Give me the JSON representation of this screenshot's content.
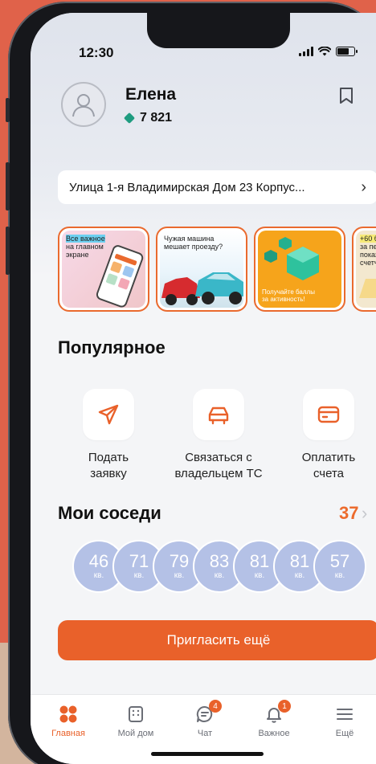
{
  "status_bar": {
    "time": "12:30"
  },
  "profile": {
    "name": "Елена",
    "points": "7 821"
  },
  "address": {
    "text": "Улица 1-я Владимирская Дом 23 Корпус..."
  },
  "stories": [
    {
      "text_line1": "Все важное",
      "text_line2": "на главном",
      "text_line3": "экране"
    },
    {
      "text_line1": "Чужая машина",
      "text_line2": "мешает проезду?"
    },
    {
      "text_line1": "Получайте баллы",
      "text_line2": "за активность!"
    },
    {
      "text_line1": "+60 б",
      "text_line2": "за пер",
      "text_line3": "показ",
      "text_line4": "счетч"
    }
  ],
  "popular": {
    "title": "Популярное",
    "actions": [
      {
        "label_line1": "Подать",
        "label_line2": "заявку",
        "icon": "paper-plane-icon"
      },
      {
        "label_line1": "Связаться с",
        "label_line2": "владельцем ТС",
        "icon": "car-icon"
      },
      {
        "label_line1": "Оплатить",
        "label_line2": "счета",
        "icon": "card-icon"
      }
    ]
  },
  "neighbors": {
    "title": "Мои соседи",
    "count": "37",
    "apartments": [
      {
        "number": "46",
        "suffix": "кв."
      },
      {
        "number": "71",
        "suffix": "кв."
      },
      {
        "number": "79",
        "suffix": "кв."
      },
      {
        "number": "83",
        "suffix": "кв."
      },
      {
        "number": "81",
        "suffix": "кв."
      },
      {
        "number": "81",
        "suffix": "кв."
      },
      {
        "number": "57",
        "suffix": "кв."
      }
    ]
  },
  "invite_button": "Пригласить ещё",
  "tabbar": {
    "items": [
      {
        "label": "Главная",
        "active": true
      },
      {
        "label": "Мой дом"
      },
      {
        "label": "Чат",
        "badge": "4"
      },
      {
        "label": "Важное",
        "badge": "1"
      },
      {
        "label": "Ещё"
      }
    ]
  },
  "colors": {
    "accent": "#e9612a",
    "avatar_bubble": "#b4c1e6",
    "gem": "#1f9c80"
  }
}
